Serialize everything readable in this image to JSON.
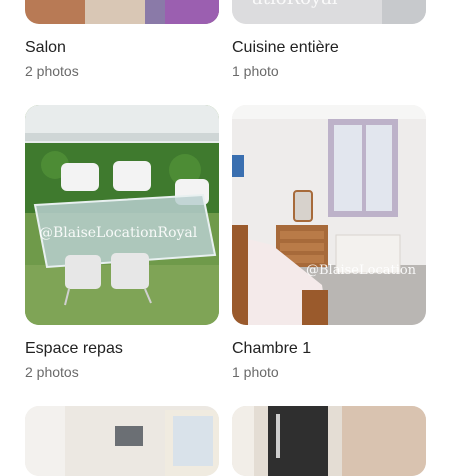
{
  "rooms": [
    {
      "name": "Salon",
      "count": "2 photos"
    },
    {
      "name": "Cuisine entière",
      "count": "1 photo"
    },
    {
      "name": "Espace repas",
      "count": "2 photos"
    },
    {
      "name": "Chambre 1",
      "count": "1 photo"
    }
  ],
  "watermarks": {
    "dining": "@BlaiseLocationRoyal",
    "bedroom": "@BlaiseLocation",
    "kitchen_partial": "atioRoyal"
  }
}
